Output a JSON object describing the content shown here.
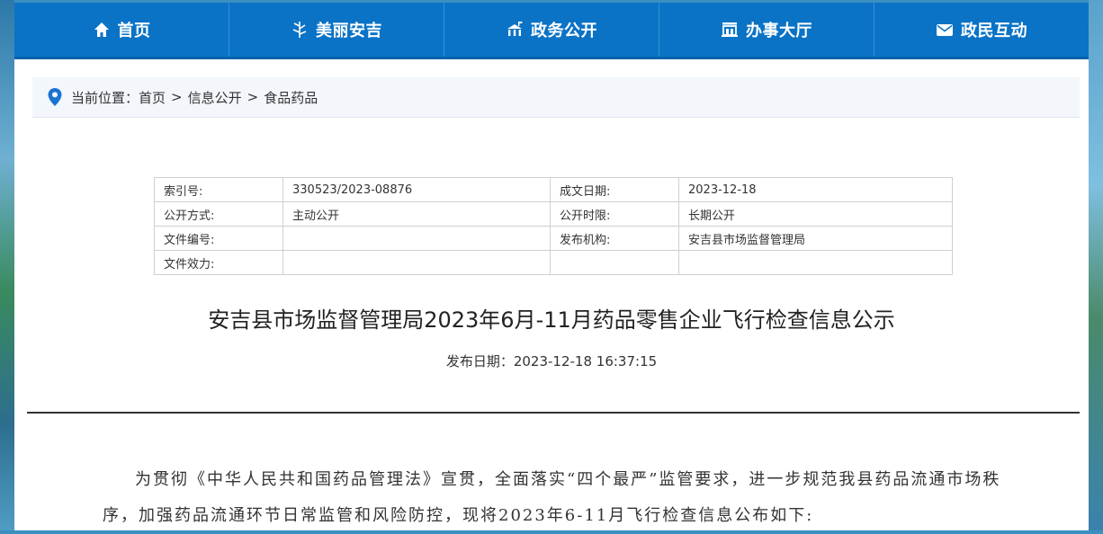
{
  "nav": {
    "items": [
      {
        "label": "首页",
        "icon": "home-icon"
      },
      {
        "label": "美丽安吉",
        "icon": "bamboo-icon"
      },
      {
        "label": "政务公开",
        "icon": "government-icon"
      },
      {
        "label": "办事大厅",
        "icon": "building-icon"
      },
      {
        "label": "政民互动",
        "icon": "envelope-icon"
      }
    ]
  },
  "breadcrumb": {
    "prefix": "当前位置：",
    "items": [
      "首页",
      "信息公开",
      "食品药品"
    ],
    "separator": ">"
  },
  "meta": {
    "rows": [
      [
        "索引号:",
        "330523/2023-08876",
        "成文日期:",
        "2023-12-18"
      ],
      [
        "公开方式:",
        "主动公开",
        "公开时限:",
        "长期公开"
      ],
      [
        "文件编号:",
        "",
        "发布机构:",
        "安吉县市场监督管理局"
      ],
      [
        "文件效力:",
        "",
        "",
        ""
      ]
    ]
  },
  "article": {
    "title": "安吉县市场监督管理局2023年6月-11月药品零售企业飞行检查信息公示",
    "date": "发布日期：2023-12-18 16:37:15",
    "body": "为贯彻《中华人民共和国药品管理法》宣贯，全面落实“四个最严”监管要求，进一步规范我县药品流通市场秩序，加强药品流通环节日常监管和风险防控，现将2023年6-11月飞行检查信息公布如下:"
  },
  "colors": {
    "nav_bg": "#0a73c6",
    "pin": "#1a73d1"
  }
}
